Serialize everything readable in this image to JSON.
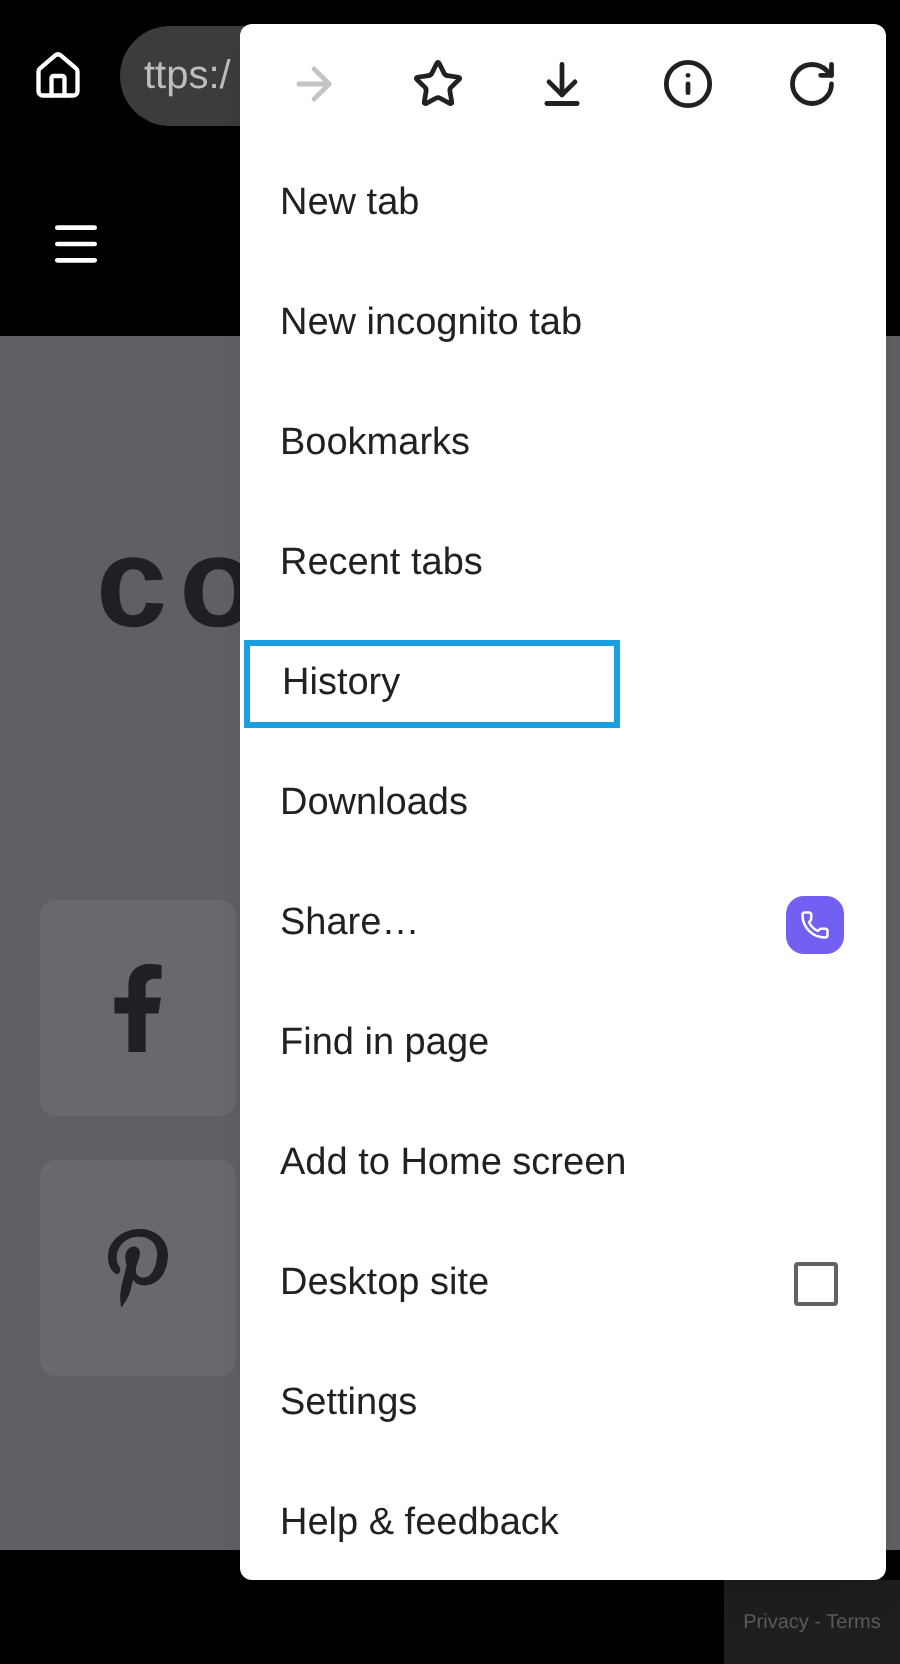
{
  "browser": {
    "url": "ttps:/"
  },
  "page": {
    "headline": "co",
    "footer": "Privacy - Terms"
  },
  "menu": {
    "toolbar": [
      {
        "kind": "forward",
        "disabled": true
      },
      {
        "kind": "bookmark",
        "disabled": false
      },
      {
        "kind": "download",
        "disabled": false
      },
      {
        "kind": "info",
        "disabled": false
      },
      {
        "kind": "reload",
        "disabled": false
      }
    ],
    "items": [
      {
        "label": "New tab",
        "kind": "plain",
        "selected": false
      },
      {
        "label": "New incognito tab",
        "kind": "plain",
        "selected": false
      },
      {
        "label": "Bookmarks",
        "kind": "plain",
        "selected": false
      },
      {
        "label": "Recent tabs",
        "kind": "plain",
        "selected": false
      },
      {
        "label": "History",
        "kind": "plain",
        "selected": true
      },
      {
        "label": "Downloads",
        "kind": "plain",
        "selected": false
      },
      {
        "label": "Share…",
        "kind": "share",
        "selected": false
      },
      {
        "label": "Find in page",
        "kind": "plain",
        "selected": false
      },
      {
        "label": "Add to Home screen",
        "kind": "plain",
        "selected": false
      },
      {
        "label": "Desktop site",
        "kind": "checkbox",
        "checked": false,
        "selected": false
      },
      {
        "label": "Settings",
        "kind": "plain",
        "selected": false
      },
      {
        "label": "Help & feedback",
        "kind": "plain",
        "selected": false
      }
    ]
  }
}
